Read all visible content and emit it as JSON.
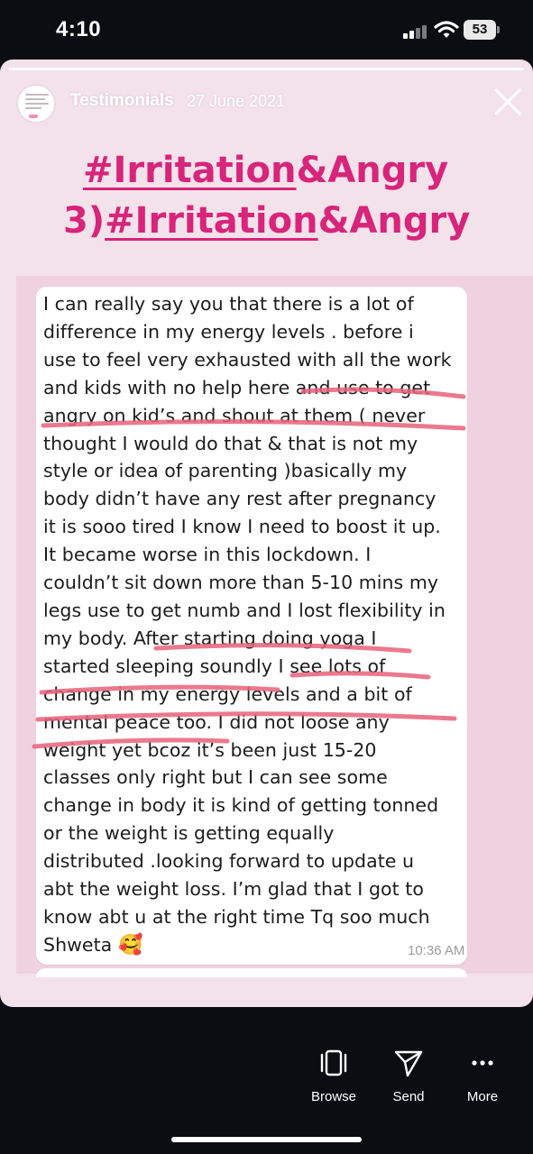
{
  "status_bar": {
    "time": "4:10",
    "battery": "53",
    "icons": [
      "cellular-signal-icon",
      "wifi-icon",
      "battery-icon"
    ]
  },
  "story": {
    "progress": 1.0,
    "account_name": "Testimonials",
    "date": "27 June 2021",
    "close_icon": "close-icon"
  },
  "headline": {
    "line1_tag": "#Irritation",
    "line1_rest": "&Angry",
    "line2_prefix": "3)",
    "line2_tag": "#Irritation",
    "line2_rest": "&Angry"
  },
  "message": {
    "lines": [
      "I can really say you that there is a lot of",
      "difference in my energy levels . before i",
      "use to feel very exhausted with all the work",
      "and kids with no help here and use to get",
      "angry on kid’s and shout at them ( never",
      "thought I would do that & that is not my",
      "style or idea of parenting )basically my",
      "body didn’t have any rest after pregnancy",
      "it is sooo tired I know I need to boost it up.",
      "It became worse in this lockdown. I",
      "couldn’t sit down more than 5-10 mins my",
      "legs use to get numb and I lost flexibility in",
      "my body. After starting doing yoga I",
      "started sleeping soundly I see lots of",
      "change in my energy levels and a bit of",
      "mental peace too. I did not loose any",
      "weight yet bcoz it’s been just 15-20",
      "classes only right but I can see some",
      "change in body it is kind of getting tonned",
      "or the weight is getting equally",
      "distributed .looking forward to update u",
      "abt the weight loss. I’m glad that I got to",
      "know abt u at the right time Tq soo much",
      "Shweta"
    ],
    "emoji": "🥰",
    "time": "10:36 AM"
  },
  "colors": {
    "accent": "#d8247a",
    "highlight": "#e8627a",
    "story_bg": "#f4e2ea",
    "chat_bg": "#efd1e0"
  },
  "actions": [
    {
      "label": "Browse",
      "icon": "browse-icon"
    },
    {
      "label": "Send",
      "icon": "send-icon"
    },
    {
      "label": "More",
      "icon": "more-icon"
    }
  ]
}
